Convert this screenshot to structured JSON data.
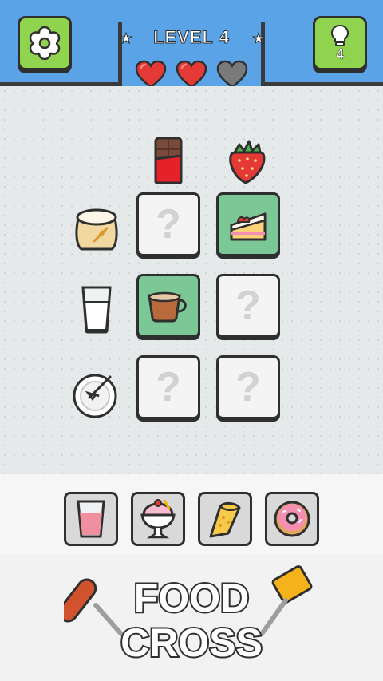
{
  "header": {
    "level_title": "LEVEL 4",
    "hint_count": "4",
    "lives_total": 3,
    "lives_remaining": 2,
    "settings_icon": "gear-icon",
    "hint_icon": "lightbulb-icon"
  },
  "board": {
    "column_clues": [
      "chocolate-bar-icon",
      "strawberry-icon"
    ],
    "row_clues": [
      "flour-sack-icon",
      "milk-glass-icon",
      "whisk-bowl-icon"
    ],
    "cells": [
      [
        "?",
        "strawberry-cake-icon"
      ],
      [
        "coffee-cup-icon",
        "?"
      ],
      [
        "?",
        "?"
      ]
    ],
    "empty_mark": "?"
  },
  "options": [
    "strawberry-milk-icon",
    "ice-cream-sundae-icon",
    "crepe-icon",
    "donut-icon"
  ],
  "logo": {
    "line1": "FOOD",
    "line2": "CROSS"
  },
  "colors": {
    "header_blue": "#5aa3e6",
    "button_green": "#8fd34f",
    "filled_tile": "#7bc896",
    "heart_red": "#e53935",
    "heart_lost": "#7a7a7a"
  }
}
